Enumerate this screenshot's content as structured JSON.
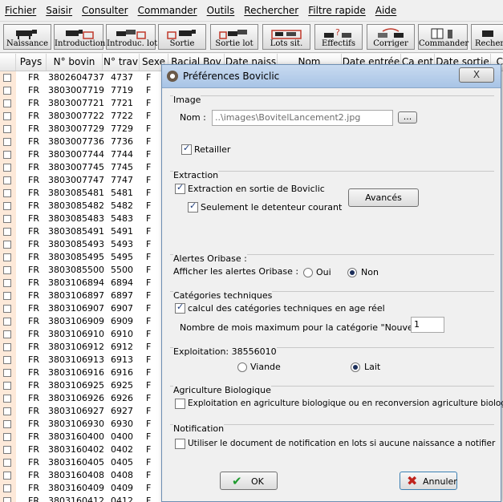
{
  "menu": [
    "Fichier",
    "Saisir",
    "Consulter",
    "Commander",
    "Outils",
    "Rechercher",
    "Filtre rapide",
    "Aide"
  ],
  "toolbar": [
    "Naissance",
    "Introduction",
    "Introduc. lot",
    "Sortie",
    "Sortie lot",
    "Lots sit.",
    "Effectifs",
    "Corriger",
    "Commander",
    "Recher"
  ],
  "table": {
    "headers": [
      "Pays",
      "N° bovin",
      "N° trav",
      "Sexe",
      "Racial Bov",
      "Date naiss",
      "Nom",
      "Date entrée",
      "Ca ent",
      "Date sortie",
      "Ca"
    ],
    "rows": [
      [
        "FR",
        "3802604737",
        "4737",
        "F"
      ],
      [
        "FR",
        "3803007719",
        "7719",
        "F"
      ],
      [
        "FR",
        "3803007721",
        "7721",
        "F"
      ],
      [
        "FR",
        "3803007722",
        "7722",
        "F"
      ],
      [
        "FR",
        "3803007729",
        "7729",
        "F"
      ],
      [
        "FR",
        "3803007736",
        "7736",
        "F"
      ],
      [
        "FR",
        "3803007744",
        "7744",
        "F"
      ],
      [
        "FR",
        "3803007745",
        "7745",
        "F"
      ],
      [
        "FR",
        "3803007747",
        "7747",
        "F"
      ],
      [
        "FR",
        "3803085481",
        "5481",
        "F"
      ],
      [
        "FR",
        "3803085482",
        "5482",
        "F"
      ],
      [
        "FR",
        "3803085483",
        "5483",
        "F"
      ],
      [
        "FR",
        "3803085491",
        "5491",
        "F"
      ],
      [
        "FR",
        "3803085493",
        "5493",
        "F"
      ],
      [
        "FR",
        "3803085495",
        "5495",
        "F"
      ],
      [
        "FR",
        "3803085500",
        "5500",
        "F"
      ],
      [
        "FR",
        "3803106894",
        "6894",
        "F"
      ],
      [
        "FR",
        "3803106897",
        "6897",
        "F"
      ],
      [
        "FR",
        "3803106907",
        "6907",
        "F"
      ],
      [
        "FR",
        "3803106909",
        "6909",
        "F"
      ],
      [
        "FR",
        "3803106910",
        "6910",
        "F"
      ],
      [
        "FR",
        "3803106912",
        "6912",
        "F"
      ],
      [
        "FR",
        "3803106913",
        "6913",
        "F"
      ],
      [
        "FR",
        "3803106916",
        "6916",
        "F"
      ],
      [
        "FR",
        "3803106925",
        "6925",
        "F"
      ],
      [
        "FR",
        "3803106926",
        "6926",
        "F"
      ],
      [
        "FR",
        "3803106927",
        "6927",
        "F"
      ],
      [
        "FR",
        "3803106930",
        "6930",
        "F"
      ],
      [
        "FR",
        "3803160400",
        "0400",
        "F"
      ],
      [
        "FR",
        "3803160402",
        "0402",
        "F"
      ],
      [
        "FR",
        "3803160405",
        "0405",
        "F"
      ],
      [
        "FR",
        "3803160408",
        "0408",
        "F"
      ],
      [
        "FR",
        "3803160409",
        "0409",
        "F"
      ],
      [
        "FR",
        "3803160412",
        "0412",
        "F"
      ]
    ]
  },
  "dialog": {
    "title": "Préférences Boviclic",
    "close_label": "X",
    "image": {
      "section": "Image",
      "nom_label": "Nom :",
      "nom_value": "..\\images\\BovitelLancement2.jpg",
      "browse_label": "...",
      "retailler_label": "Retailler",
      "retailler_checked": true
    },
    "extraction": {
      "section": "Extraction",
      "sortie_label": "Extraction en sortie de Boviclic",
      "sortie_checked": true,
      "detenteur_label": "Seulement le detenteur courant",
      "detenteur_checked": true,
      "avances_label": "Avancés"
    },
    "alertes": {
      "section": "Alertes Oribase :",
      "label": "Afficher les alertes Oribase :",
      "oui": "Oui",
      "non": "Non",
      "selected": "Non"
    },
    "categories": {
      "section": "Catégories techniques",
      "calcul_label": "calcul des catégories techniques en age réel",
      "calcul_checked": true,
      "nouveau_label": "Nombre de mois maximum pour la catégorie \"Nouveau né\"",
      "nouveau_value": "1"
    },
    "exploitation": {
      "section": "Exploitation: 38556010",
      "viande": "Viande",
      "lait": "Lait",
      "selected": "Lait"
    },
    "bio": {
      "section": "Agriculture Biologique",
      "label": "Exploitation en agriculture biologique ou en reconversion agriculture biologique",
      "checked": false
    },
    "notification": {
      "section": "Notification",
      "label": "Utiliser le document de notification en lots si aucune naissance a notifier",
      "checked": false
    },
    "ok_label": "OK",
    "annuler_label": "Annuler"
  }
}
